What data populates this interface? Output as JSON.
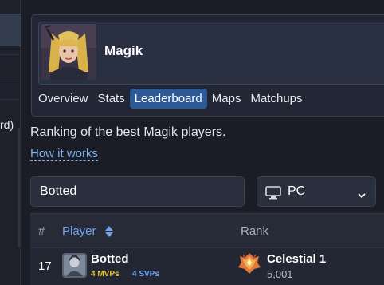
{
  "sidebar": {
    "fragment_text": "rd)"
  },
  "hero": {
    "name": "Magik",
    "portrait_icon": "magik-portrait"
  },
  "tabs": [
    {
      "label": "Overview",
      "active": false
    },
    {
      "label": "Stats",
      "active": false
    },
    {
      "label": "Leaderboard",
      "active": true
    },
    {
      "label": "Maps",
      "active": false
    },
    {
      "label": "Matchups",
      "active": false
    }
  ],
  "description": "Ranking of the best Magik players.",
  "how_it_works": "How it works",
  "search": {
    "value": "Botted"
  },
  "platform": {
    "selected": "PC",
    "icon": "monitor-icon"
  },
  "table": {
    "headers": {
      "num": "#",
      "player": "Player",
      "rank": "Rank"
    },
    "rows": [
      {
        "position": "17",
        "player": "Botted",
        "mvps": "4 MVPs",
        "svps": "4 SVPs",
        "rank": "Celestial 1",
        "score": "5,001"
      }
    ]
  },
  "colors": {
    "background": "#1b1d26",
    "accent_blue": "#2d5a96",
    "link": "#7fb2f0",
    "mvp_gold": "#e5c238",
    "svp_blue": "#6ea2f0"
  }
}
